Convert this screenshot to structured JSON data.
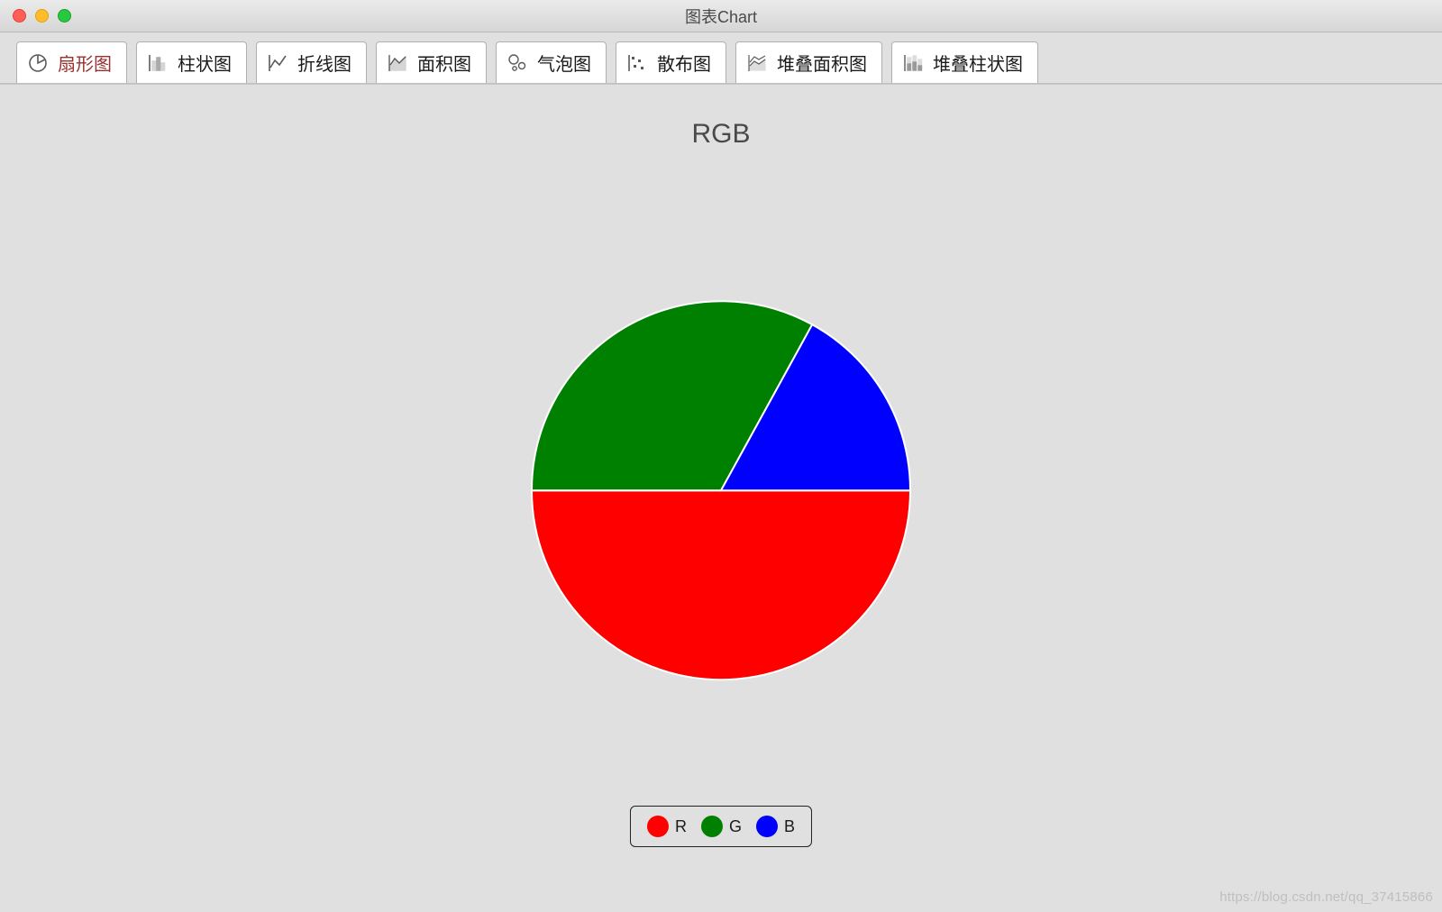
{
  "window": {
    "title": "图表Chart"
  },
  "tabs": [
    {
      "label": "扇形图",
      "icon": "pie-icon",
      "active": true
    },
    {
      "label": "柱状图",
      "icon": "bar-icon",
      "active": false
    },
    {
      "label": "折线图",
      "icon": "line-icon",
      "active": false
    },
    {
      "label": "面积图",
      "icon": "area-icon",
      "active": false
    },
    {
      "label": "气泡图",
      "icon": "bubble-icon",
      "active": false
    },
    {
      "label": "散布图",
      "icon": "scatter-icon",
      "active": false
    },
    {
      "label": "堆叠面积图",
      "icon": "stacked-area-icon",
      "active": false
    },
    {
      "label": "堆叠柱状图",
      "icon": "stacked-bar-icon",
      "active": false
    }
  ],
  "chart_data": {
    "type": "pie",
    "title": "RGB",
    "categories": [
      "R",
      "G",
      "B"
    ],
    "values": [
      50,
      33,
      17
    ],
    "colors": [
      "#ff0000",
      "#008000",
      "#0000ff"
    ],
    "legend": {
      "position": "bottom"
    }
  },
  "watermark": "https://blog.csdn.net/qq_37415866"
}
